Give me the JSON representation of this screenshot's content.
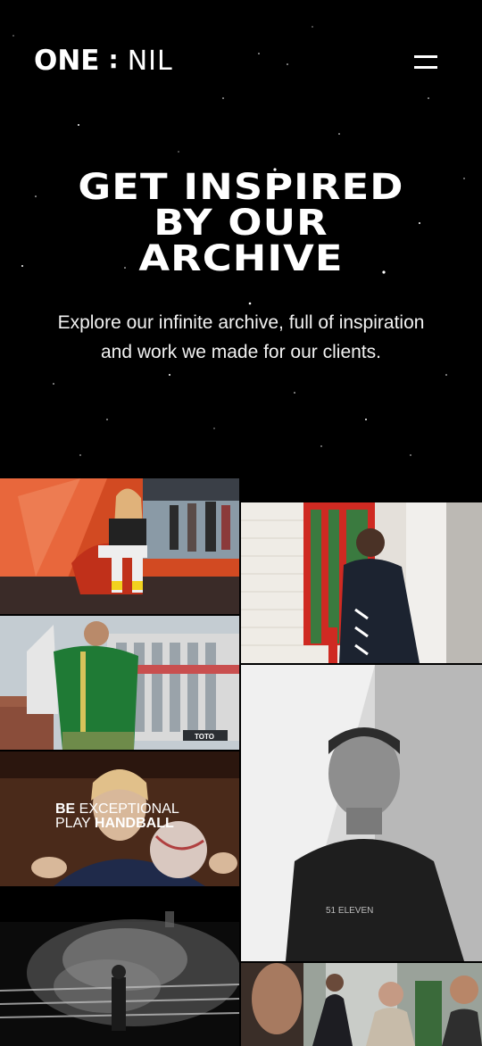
{
  "header": {
    "logo": {
      "one": "ONE",
      "colon": ":",
      "nil": "NIL"
    },
    "menu_icon": "hamburger-menu-icon"
  },
  "hero": {
    "title_lines": [
      "GET INSPIRED",
      "BY OUR",
      "ARCHIVE"
    ],
    "subtitle_line1": "Explore our infinite archive, full of inspiration",
    "subtitle_line2": "and work we made for our clients."
  },
  "tiles": {
    "handball": {
      "line1_bold": "BE",
      "line1_rest": " EXCEPTIONAL",
      "line2_rest": "PLAY ",
      "line2_bold": "HANDBALL"
    },
    "stadium_sign": "TOTO"
  },
  "colors": {
    "background": "#000000",
    "text": "#ffffff"
  }
}
